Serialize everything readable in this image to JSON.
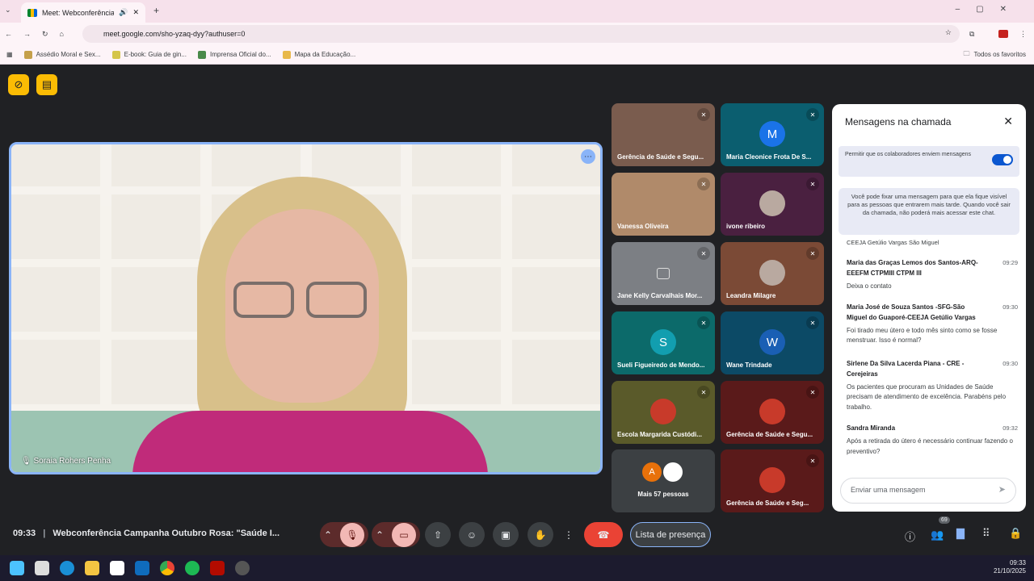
{
  "browser": {
    "tab_title": "Meet: Webconferência Cam",
    "url": "meet.google.com/sho-yzaq-dyy?authuser=0",
    "bookmarks": [
      "Assédio Moral e Sex...",
      "E-book: Guia de gin...",
      "Imprensa Oficial do...",
      "Mapa da Educação..."
    ],
    "all_favorites": "Todos os favoritos"
  },
  "main_video": {
    "name": "Soraia Rohers Penha"
  },
  "tiles": [
    {
      "name": "Gerência de Saúde e Segu...",
      "kind": "video",
      "color": "#7a5c4e"
    },
    {
      "name": "Maria Cleonice Frota De S...",
      "kind": "avatar",
      "initial": "M",
      "color": "#0b5e6f",
      "avatar_color": "#1a73e8"
    },
    {
      "name": "Vanessa Oliveira",
      "kind": "video",
      "color": "#b08a6a"
    },
    {
      "name": "ivone ribeiro",
      "kind": "photo",
      "color": "#4a2040"
    },
    {
      "name": "Jane Kelly Carvalhais Mor...",
      "kind": "icon",
      "color": "#7c7f84"
    },
    {
      "name": "Leandra Milagre",
      "kind": "photo",
      "color": "#7b4a36"
    },
    {
      "name": "Sueli Figueiredo de Mendo...",
      "kind": "avatar",
      "initial": "S",
      "color": "#0c6a6a",
      "avatar_color": "#129eaf"
    },
    {
      "name": "Wane Trindade",
      "kind": "avatar",
      "initial": "W",
      "color": "#0c4a66",
      "avatar_color": "#1a5fb4"
    },
    {
      "name": "Escola Margarida Custódi...",
      "kind": "logo",
      "color": "#5a5a2a"
    },
    {
      "name": "Gerência de Saúde e Segu...",
      "kind": "logo",
      "color": "#5a1a1a"
    },
    {
      "name": "Mais 57 pessoas",
      "kind": "more",
      "color": "#3c4043"
    },
    {
      "name": "Gerência de Saúde e Seg...",
      "kind": "logo",
      "color": "#5a1a1a"
    }
  ],
  "chat": {
    "title": "Mensagens na chamada",
    "toggle_label": "Permitir que os colaboradores enviem mensagens",
    "info": "Você pode fixar uma mensagem para que ela fique visível para as pessoas que entrarem mais tarde. Quando você sair da chamada, não poderá mais acessar este chat.",
    "cut_line": "CEEJA Getúlio Vargas São Miguel",
    "messages": [
      {
        "who": "Maria das Graças Lemos dos Santos-ARQ-EEEFM CTPMIII CTPM III",
        "time": "09:29",
        "text": "Deixa o contato"
      },
      {
        "who": "Maria José de Souza Santos -SFG-São Miguel do Guaporé-CEEJA Getúlio Vargas",
        "time": "09:30",
        "text": "Foi tirado meu útero e todo mês sinto como se fosse menstruar. Isso é normal?"
      },
      {
        "who": "Sirlene Da Silva Lacerda Piana - CRE - Cerejeiras",
        "time": "09:30",
        "text": "Os pacientes que procuram  as Unidades de Saúde precisam de atendimento de excelência. Parabéns pelo trabalho."
      },
      {
        "who": "Sandra Miranda",
        "time": "09:32",
        "text": "Após a retirada do útero é necessário continuar fazendo o preventivo?"
      }
    ],
    "placeholder": "Enviar uma mensagem"
  },
  "bottom": {
    "time": "09:33",
    "meeting_title": "Webconferência Campanha Outubro Rosa: \"Saúde I...",
    "attendance": "Lista de presença",
    "participants_badge": "69",
    "more_initial": "A"
  },
  "taskbar": {
    "time": "09:33",
    "date": "21/10/2025"
  }
}
